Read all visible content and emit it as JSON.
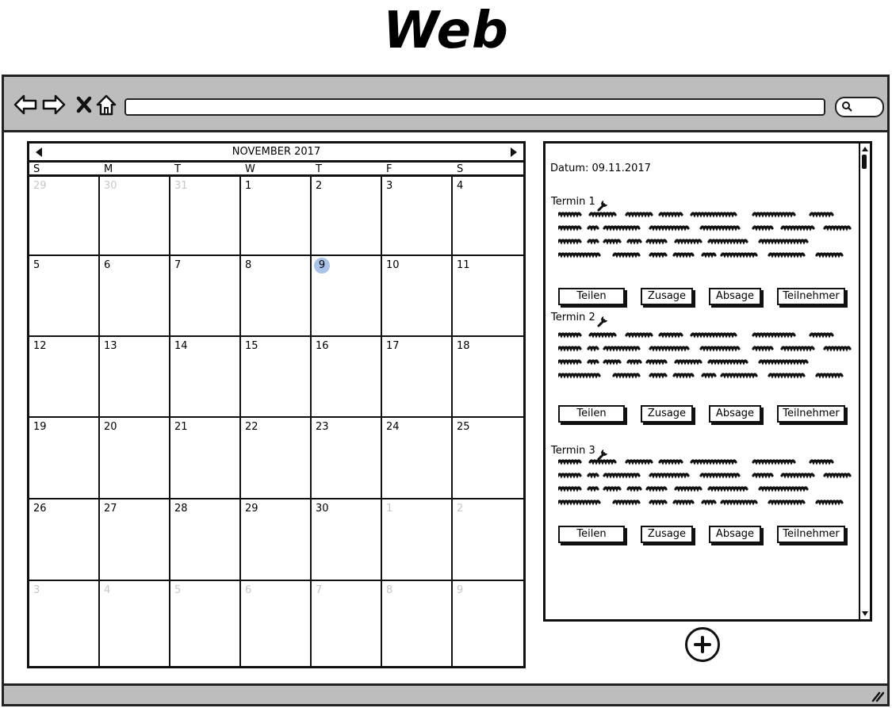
{
  "page_title": "Web",
  "calendar": {
    "month_label": "NOVEMBER 2017",
    "weekdays": [
      "S",
      "M",
      "T",
      "W",
      "T",
      "F",
      "S"
    ],
    "weeks": [
      [
        {
          "d": "29",
          "m": true
        },
        {
          "d": "30",
          "m": true
        },
        {
          "d": "31",
          "m": true
        },
        {
          "d": "1"
        },
        {
          "d": "2"
        },
        {
          "d": "3"
        },
        {
          "d": "4"
        }
      ],
      [
        {
          "d": "5"
        },
        {
          "d": "6"
        },
        {
          "d": "7"
        },
        {
          "d": "8"
        },
        {
          "d": "9",
          "sel": true
        },
        {
          "d": "10"
        },
        {
          "d": "11"
        }
      ],
      [
        {
          "d": "12"
        },
        {
          "d": "13"
        },
        {
          "d": "14"
        },
        {
          "d": "15"
        },
        {
          "d": "16"
        },
        {
          "d": "17"
        },
        {
          "d": "18"
        }
      ],
      [
        {
          "d": "19"
        },
        {
          "d": "20"
        },
        {
          "d": "21"
        },
        {
          "d": "22"
        },
        {
          "d": "23"
        },
        {
          "d": "24"
        },
        {
          "d": "25"
        }
      ],
      [
        {
          "d": "26"
        },
        {
          "d": "27"
        },
        {
          "d": "28"
        },
        {
          "d": "29"
        },
        {
          "d": "30"
        },
        {
          "d": "1",
          "m": true
        },
        {
          "d": "2",
          "m": true
        }
      ],
      [
        {
          "d": "3",
          "m": true
        },
        {
          "d": "4",
          "m": true
        },
        {
          "d": "5",
          "m": true
        },
        {
          "d": "6",
          "m": true
        },
        {
          "d": "7",
          "m": true
        },
        {
          "d": "8",
          "m": true
        },
        {
          "d": "9",
          "m": true
        }
      ]
    ],
    "selected_day": "9"
  },
  "panel": {
    "datum": "Datum: 09.11.2017",
    "termine": [
      {
        "title": "Termin 1"
      },
      {
        "title": "Termin 2"
      },
      {
        "title": "Termin 3"
      }
    ],
    "buttons": [
      "Teilen",
      "Zusage",
      "Absage",
      "Teilnehmer"
    ]
  },
  "icons": {
    "back": "arrow-left-icon",
    "forward": "arrow-right-icon",
    "stop": "close-icon",
    "home": "home-icon",
    "search": "search-icon",
    "edit": "wrench-icon",
    "add": "plus-circle-icon"
  },
  "colors": {
    "chrome": "#bdbdbd",
    "selected_day": "#a9c4ea",
    "muted_day": "#c8c8c8"
  }
}
